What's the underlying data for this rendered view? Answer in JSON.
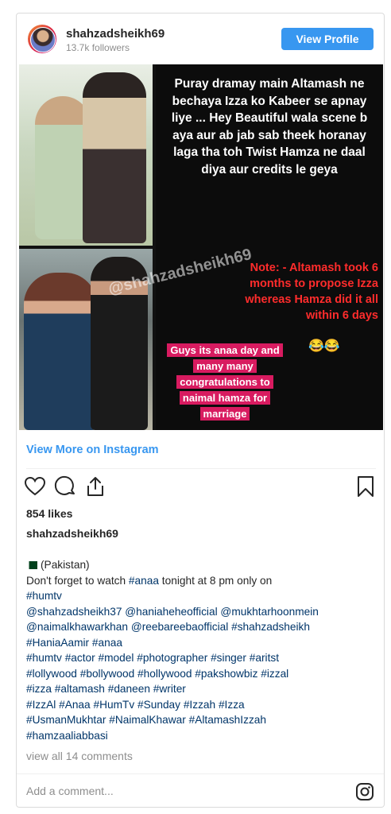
{
  "header": {
    "username": "shahzadsheikh69",
    "followers": "13.7k followers",
    "view_profile_label": "View Profile"
  },
  "post_image": {
    "quote_text": "Puray dramay main Altamash ne bechaya Izza ko Kabeer se apnay liye ... Hey Beautiful wala scene b aya aur  ab jab sab theek horanay laga tha toh Twist Hamza ne daal diya aur credits le geya",
    "note_text": "Note: - Altamash took 6 months to propose Izza whereas Hamza did it all within 6 days",
    "emoji": "😂😂",
    "pink_caption": "Guys its anaa day and many many congratulations to naimal hamza for marriage",
    "watermark": "@shahzadsheikh69"
  },
  "view_more_label": "View More on Instagram",
  "actions": {
    "like_icon": "heart-icon",
    "comment_icon": "comment-icon",
    "share_icon": "share-icon",
    "save_icon": "bookmark-icon"
  },
  "likes": "854 likes",
  "caption": {
    "owner": "shahzadsheikh69",
    "location": "(Pakistan)",
    "line1_text": "Don't forget to watch ",
    "line1_tag": "#anaa",
    "line1_rest": " tonight at 8 pm only on",
    "tags": [
      "#humtv",
      "@shahzadsheikh37 @haniaheheofficial @mukhtarhoonmein",
      "@naimalkhawarkhan @reebareebaofficial #shahzadsheikh",
      "#HaniaAamir #anaa",
      "#humtv #actor #model #photographer #singer #aritst",
      "#lollywood #bollywood #hollywood #pakshowbiz #izzal",
      "#izza #altamash #daneen #writer",
      "#IzzAl #Anaa #HumTv #Sunday #Izzah #Izza",
      "#UsmanMukhtar #NaimalKhawar #AltamashIzzah",
      "#hamzaaliabbasi"
    ]
  },
  "view_comments": "view all 14 comments",
  "comment_placeholder": "Add a comment...",
  "instagram_icon": "instagram-icon",
  "colors": {
    "accent": "#3897f0",
    "pink": "#d81b60",
    "note_red": "#ff2c2c"
  }
}
